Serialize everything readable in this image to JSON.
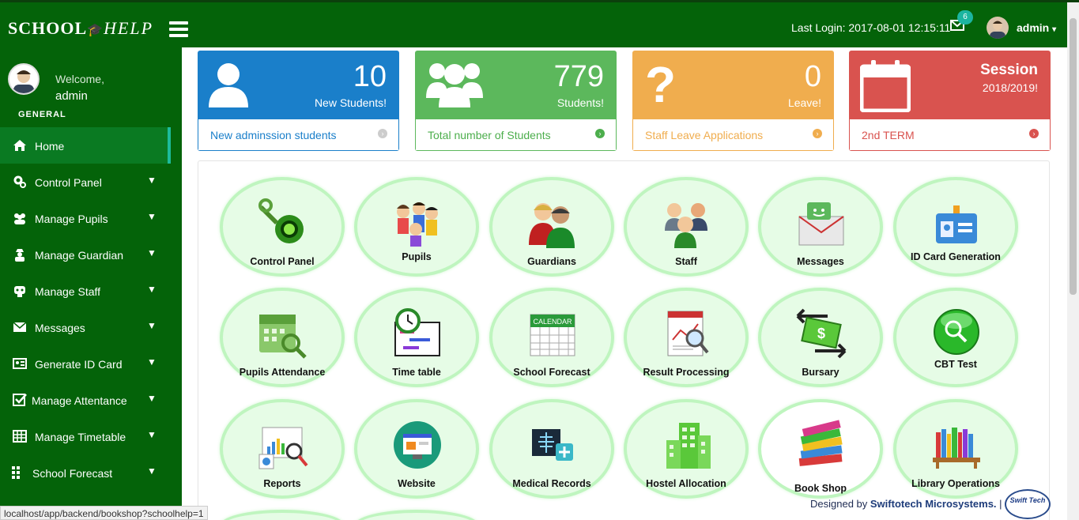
{
  "header": {
    "logo_school": "SCHOOL",
    "logo_help": "HELP",
    "last_login": "Last Login: 2017-08-01 12:15:11",
    "mail_count": "6",
    "user": "admin"
  },
  "sidebar": {
    "welcome": "Welcome,",
    "name": "admin",
    "section": "GENERAL",
    "items": [
      {
        "label": "Home",
        "icon": "home-icon"
      },
      {
        "label": "Control Panel",
        "icon": "gears-icon"
      },
      {
        "label": "Manage Pupils",
        "icon": "users-icon"
      },
      {
        "label": "Manage Guardian",
        "icon": "user-secret-icon"
      },
      {
        "label": "Manage Staff",
        "icon": "staff-icon"
      },
      {
        "label": "Messages",
        "icon": "envelope-icon"
      },
      {
        "label": "Generate ID Card",
        "icon": "id-card-icon"
      },
      {
        "label": "Manage Attentance",
        "icon": "check-square-icon"
      },
      {
        "label": "Manage Timetable",
        "icon": "table-icon"
      },
      {
        "label": "School Forecast",
        "icon": "grid-icon"
      }
    ]
  },
  "stats": [
    {
      "value": "10",
      "label": "New Students!",
      "link": "New adminssion students",
      "color": "#1a7fca"
    },
    {
      "value": "779",
      "label": "Students!",
      "link": "Total number of Students",
      "color": "#5cb85c"
    },
    {
      "value": "0",
      "label": "Leave!",
      "link": "Staff Leave Applications",
      "color": "#f0ad4e"
    },
    {
      "title": "Session",
      "year": "2018/2019!",
      "link": "2nd TERM",
      "color": "#d9534f"
    }
  ],
  "tiles": [
    {
      "label": "Control Panel",
      "icon": "gear-wrench-icon"
    },
    {
      "label": "Pupils",
      "icon": "pupils-icon"
    },
    {
      "label": "Guardians",
      "icon": "guardians-icon"
    },
    {
      "label": "Staff",
      "icon": "staff-group-icon"
    },
    {
      "label": "Messages",
      "icon": "message-envelope-icon"
    },
    {
      "label": "ID Card Generation",
      "icon": "id-badge-icon"
    },
    {
      "label": "Pupils Attendance",
      "icon": "calendar-search-icon"
    },
    {
      "label": "Time table",
      "icon": "clock-schedule-icon"
    },
    {
      "label": "School Forecast",
      "icon": "calendar-icon"
    },
    {
      "label": "Result Processing",
      "icon": "results-chart-icon"
    },
    {
      "label": "Bursary",
      "icon": "money-exchange-icon"
    },
    {
      "label": "CBT Test",
      "icon": "magnifier-button-icon"
    },
    {
      "label": "Reports",
      "icon": "report-chart-icon"
    },
    {
      "label": "Website",
      "icon": "website-icon"
    },
    {
      "label": "Medical Records",
      "icon": "xray-icon"
    },
    {
      "label": "Hostel Allocation",
      "icon": "building-icon"
    },
    {
      "label": "Book Shop",
      "icon": "books-stack-icon"
    },
    {
      "label": "Library Operations",
      "icon": "bookshelf-icon"
    }
  ],
  "footer": {
    "designed_by": "Designed by ",
    "company": "Swiftotech Microsystems.",
    "sep": " |",
    "logo": "Swift Tech"
  },
  "status_url": "localhost/app/backend/bookshop?schoolhelp=1"
}
